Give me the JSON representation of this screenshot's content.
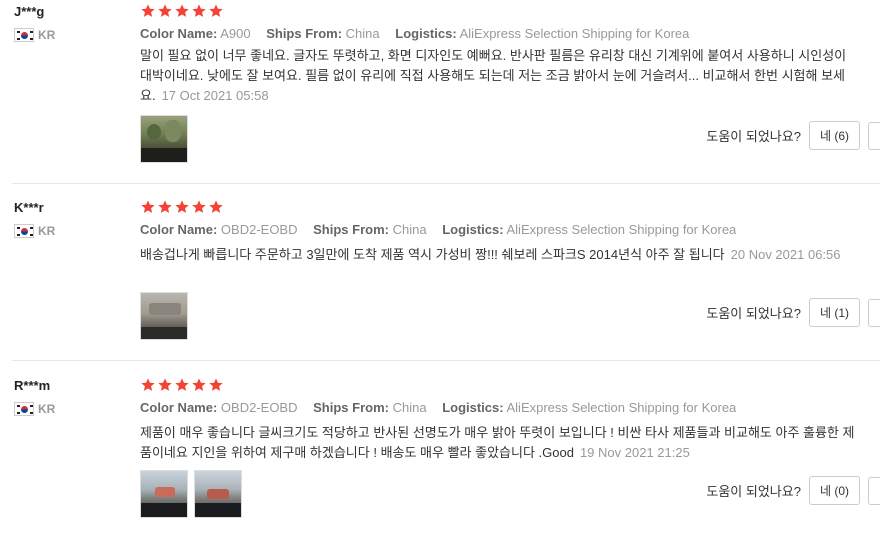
{
  "colors": {
    "star": "#f44336",
    "muted": "#999999",
    "text": "#333333"
  },
  "labels": {
    "color_name": "Color Name:",
    "ships_from": "Ships From:",
    "logistics": "Logistics:",
    "helpful": "도움이 되었나요?"
  },
  "reviews": [
    {
      "user": "J***g",
      "country": "KR",
      "rating": 5,
      "color_name": "A900",
      "ships_from": "China",
      "logistics": "AliExpress Selection Shipping for Korea",
      "text": "말이 필요 없이 너무 좋네요. 글자도 뚜렷하고, 화면 디자인도 예뻐요. 반사판 필름은 유리창 대신 기계위에 붙여서 사용하니 시인성이 대박이네요. 낮에도 잘 보여요. 필름 없이 유리에 직접 사용해도 되는데 저는 조금 밝아서 눈에 거슬려서... 비교해서 한번 시험해 보세요.",
      "date": "17 Oct 2021 05:58",
      "yes_label": "네 (6)"
    },
    {
      "user": "K***r",
      "country": "KR",
      "rating": 5,
      "color_name": "OBD2-EOBD",
      "ships_from": "China",
      "logistics": "AliExpress Selection Shipping for Korea",
      "text": "배송겁나게 빠릅니다 주문하고 3일만에 도착 제품 역시 가성비 짱!!! 쉐보레 스파크S 2014년식 아주 잘 됩니다",
      "date": "20 Nov 2021 06:56",
      "yes_label": "네 (1)"
    },
    {
      "user": "R***m",
      "country": "KR",
      "rating": 5,
      "color_name": "OBD2-EOBD",
      "ships_from": "China",
      "logistics": "AliExpress Selection Shipping for Korea",
      "text": "제품이 매우 좋습니다 글씨크기도 적당하고 반사된 선명도가 매우 밝아 뚜렷이 보입니다 ! 비싼 타사 제품들과 비교해도 아주 훌륭한 제품이네요 지인을 위하여 제구매 하겠습니다 ! 배송도 매우 빨라 좋았습니다 .Good",
      "date": "19 Nov 2021 21:25",
      "yes_label": "네 (0)"
    }
  ]
}
